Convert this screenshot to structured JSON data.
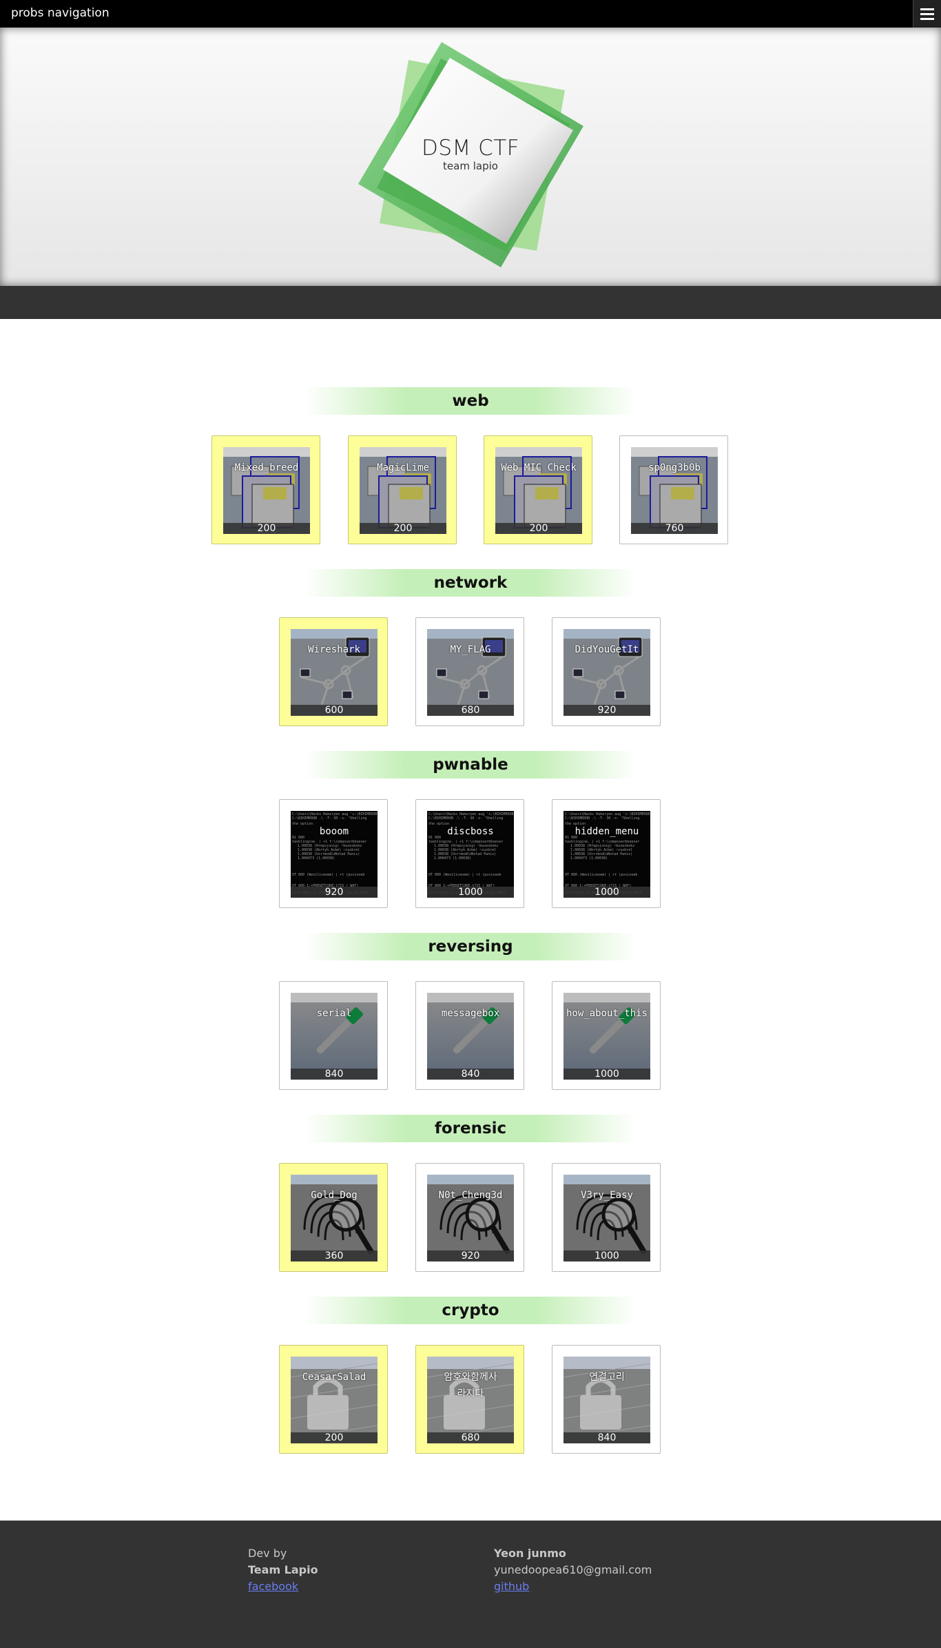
{
  "nav": {
    "brand": "probs navigation",
    "menu_icon": "hamburger-icon"
  },
  "hero": {
    "title": "DSM CTF",
    "subtitle": "team lapio",
    "colors": {
      "accent": "#3fa64a"
    }
  },
  "categories": [
    {
      "name": "web",
      "thumb": "web",
      "problems": [
        {
          "name": "Mixed_breed",
          "score": "200",
          "solved": true
        },
        {
          "name": "MagicLime",
          "score": "200",
          "solved": true
        },
        {
          "name": "Web MIC Check",
          "score": "200",
          "solved": true
        },
        {
          "name": "sp0ng3b0b",
          "score": "760",
          "solved": false
        }
      ]
    },
    {
      "name": "network",
      "thumb": "network",
      "problems": [
        {
          "name": "Wireshark",
          "score": "600",
          "solved": true
        },
        {
          "name": "MY_FLAG",
          "score": "680",
          "solved": false
        },
        {
          "name": "DidYouGetIt",
          "score": "920",
          "solved": false
        }
      ]
    },
    {
      "name": "pwnable",
      "thumb": "pwnable",
      "problems": [
        {
          "name": "booom",
          "score": "920",
          "solved": false
        },
        {
          "name": "discboss",
          "score": "1000",
          "solved": false
        },
        {
          "name": "hidden_menu",
          "score": "1000",
          "solved": false
        }
      ]
    },
    {
      "name": "reversing",
      "thumb": "reversing",
      "problems": [
        {
          "name": "serial",
          "score": "840",
          "solved": false
        },
        {
          "name": "messagebox",
          "score": "840",
          "solved": false
        },
        {
          "name": "how_about_this",
          "score": "1000",
          "solved": false
        }
      ]
    },
    {
      "name": "forensic",
      "thumb": "forensic",
      "problems": [
        {
          "name": "Gold_Dog",
          "score": "360",
          "solved": true
        },
        {
          "name": "N0t_Cheng3d",
          "score": "920",
          "solved": false
        },
        {
          "name": "V3ry_Easy",
          "score": "1000",
          "solved": false
        }
      ]
    },
    {
      "name": "crypto",
      "thumb": "crypto",
      "problems": [
        {
          "name": "CeasarSalad",
          "score": "200",
          "solved": true
        },
        {
          "name": "암호와함께사라지다",
          "score": "680",
          "solved": true
        },
        {
          "name": "연결고리",
          "score": "840",
          "solved": false
        }
      ]
    }
  ],
  "footer": {
    "dev_by": "Dev by",
    "team": "Team Lapio",
    "facebook": "facebook",
    "author": "Yeon junmo",
    "email": "yunedoopea610@gmail.com",
    "github": "github"
  }
}
